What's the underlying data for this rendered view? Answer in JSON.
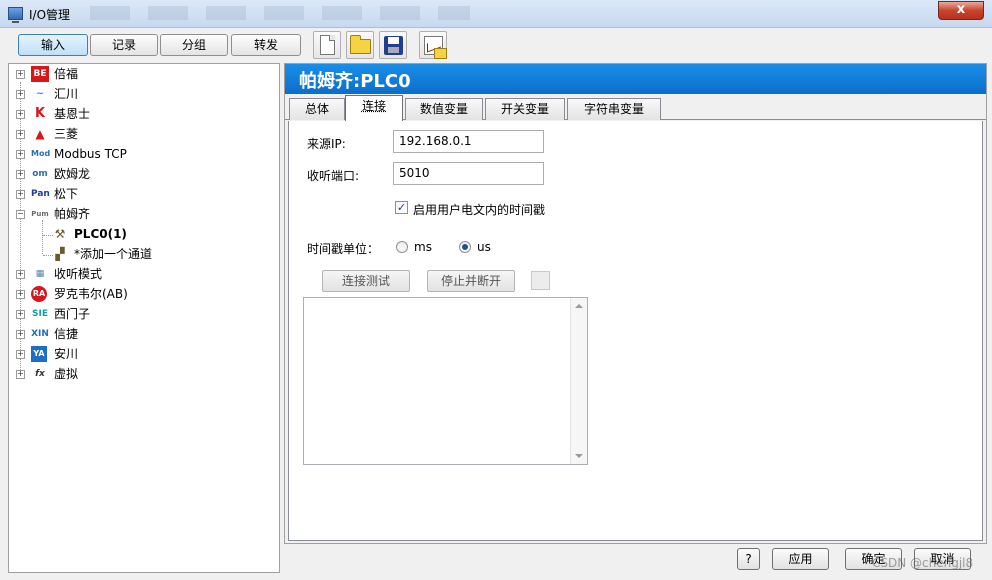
{
  "window": {
    "title": "I/O管理",
    "close_label": "x"
  },
  "toolbar": {
    "buttons": [
      "输入",
      "记录",
      "分组",
      "转发"
    ],
    "icons": [
      "new-document-icon",
      "open-folder-icon",
      "save-disk-icon",
      "chart-folder-icon"
    ]
  },
  "tree": {
    "items": [
      {
        "badge": "BE",
        "label": "倍福",
        "color": "#d8161b"
      },
      {
        "badge": "~",
        "label": "汇川",
        "color": "#1a7fc2"
      },
      {
        "badge": "K",
        "label": "基恩士",
        "color": "#d8161b"
      },
      {
        "badge": "▲",
        "label": "三菱",
        "color": "#d8161b"
      },
      {
        "badge": "Mod",
        "label": "Modbus TCP",
        "color": "#2d6db5"
      },
      {
        "badge": "om",
        "label": "欧姆龙",
        "color": "#2d6db5"
      },
      {
        "badge": "Pan",
        "label": "松下",
        "color": "#1c3f94"
      },
      {
        "badge": "Pum",
        "label": "帕姆齐",
        "color": "#6b6b6b"
      },
      {
        "badge": "▦",
        "label": "收听模式",
        "color": "#5a7fa8"
      },
      {
        "badge": "RA",
        "label": "罗克韦尔(AB)",
        "color": "#d8161b"
      },
      {
        "badge": "SIE",
        "label": "西门子",
        "color": "#129fa6"
      },
      {
        "badge": "XIN",
        "label": "信捷",
        "color": "#1c6fc4"
      },
      {
        "badge": "YA",
        "label": "安川",
        "color": "#1c6fc4"
      },
      {
        "badge": "fx",
        "label": "虚拟",
        "color": "#333333"
      }
    ],
    "children": [
      {
        "label": "PLC0(1)"
      },
      {
        "label": "*添加一个通道"
      }
    ]
  },
  "panel": {
    "title": "帕姆齐:PLC0",
    "tabs": [
      "总体",
      "连接",
      "数值变量",
      "开关变量",
      "字符串变量"
    ],
    "active_tab": "连接"
  },
  "form": {
    "source_ip_label": "来源IP:",
    "source_ip_value": "192.168.0.1",
    "listen_port_label": "收听端口:",
    "listen_port_value": "5010",
    "use_timestamp_label": "启用用户电文内的时间戳",
    "use_timestamp_checked": true,
    "timestamp_unit_label": "时间戳单位：",
    "unit_ms": "ms",
    "unit_us": "us",
    "selected_unit": "us",
    "test_connection_label": "连接测试",
    "stop_disconnect_label": "停止并断开"
  },
  "footer": {
    "help_label": "?",
    "apply_label": "应用",
    "ok_label": "确定",
    "cancel_label": "取消",
    "watermark": "CSDN @chengjl8"
  }
}
